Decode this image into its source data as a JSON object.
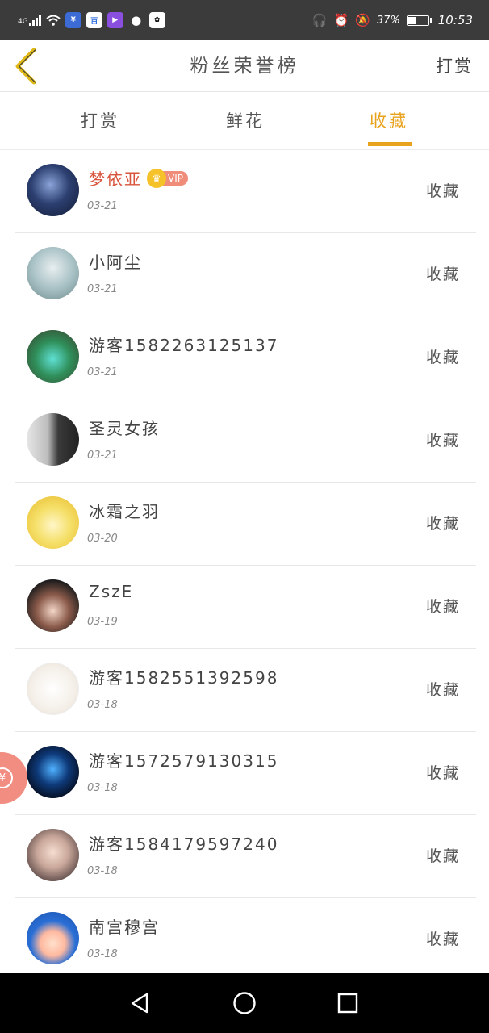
{
  "status_bar": {
    "network": "4G",
    "battery_text": "37%",
    "time": "10:53",
    "app_icons": [
      "bank-icon",
      "baidu-icon",
      "video-icon",
      "wechat-icon",
      "paw-icon"
    ]
  },
  "header": {
    "title": "粉丝荣誉榜",
    "right_action": "打赏"
  },
  "tabs": [
    {
      "label": "打赏",
      "active": false
    },
    {
      "label": "鲜花",
      "active": false
    },
    {
      "label": "收藏",
      "active": true
    }
  ],
  "vip_label": "VIP",
  "rows": [
    {
      "name": "梦依亚",
      "date": "03-21",
      "action": "收藏",
      "vip": true
    },
    {
      "name": "小阿尘",
      "date": "03-21",
      "action": "收藏",
      "vip": false
    },
    {
      "name": "游客1582263125137",
      "date": "03-21",
      "action": "收藏",
      "vip": false
    },
    {
      "name": "圣灵女孩",
      "date": "03-21",
      "action": "收藏",
      "vip": false
    },
    {
      "name": "冰霜之羽",
      "date": "03-20",
      "action": "收藏",
      "vip": false
    },
    {
      "name": "ZszE",
      "date": "03-19",
      "action": "收藏",
      "vip": false
    },
    {
      "name": "游客1582551392598",
      "date": "03-18",
      "action": "收藏",
      "vip": false
    },
    {
      "name": "游客1572579130315",
      "date": "03-18",
      "action": "收藏",
      "vip": false
    },
    {
      "name": "游客1584179597240",
      "date": "03-18",
      "action": "收藏",
      "vip": false
    },
    {
      "name": "南宫穆宫",
      "date": "03-18",
      "action": "收藏",
      "vip": false
    }
  ],
  "colors": {
    "accent": "#e9a21c",
    "vip_name": "#d9543c",
    "status_bar": "#3b3b3b"
  },
  "floating_button_icon": "yen-coin-icon"
}
